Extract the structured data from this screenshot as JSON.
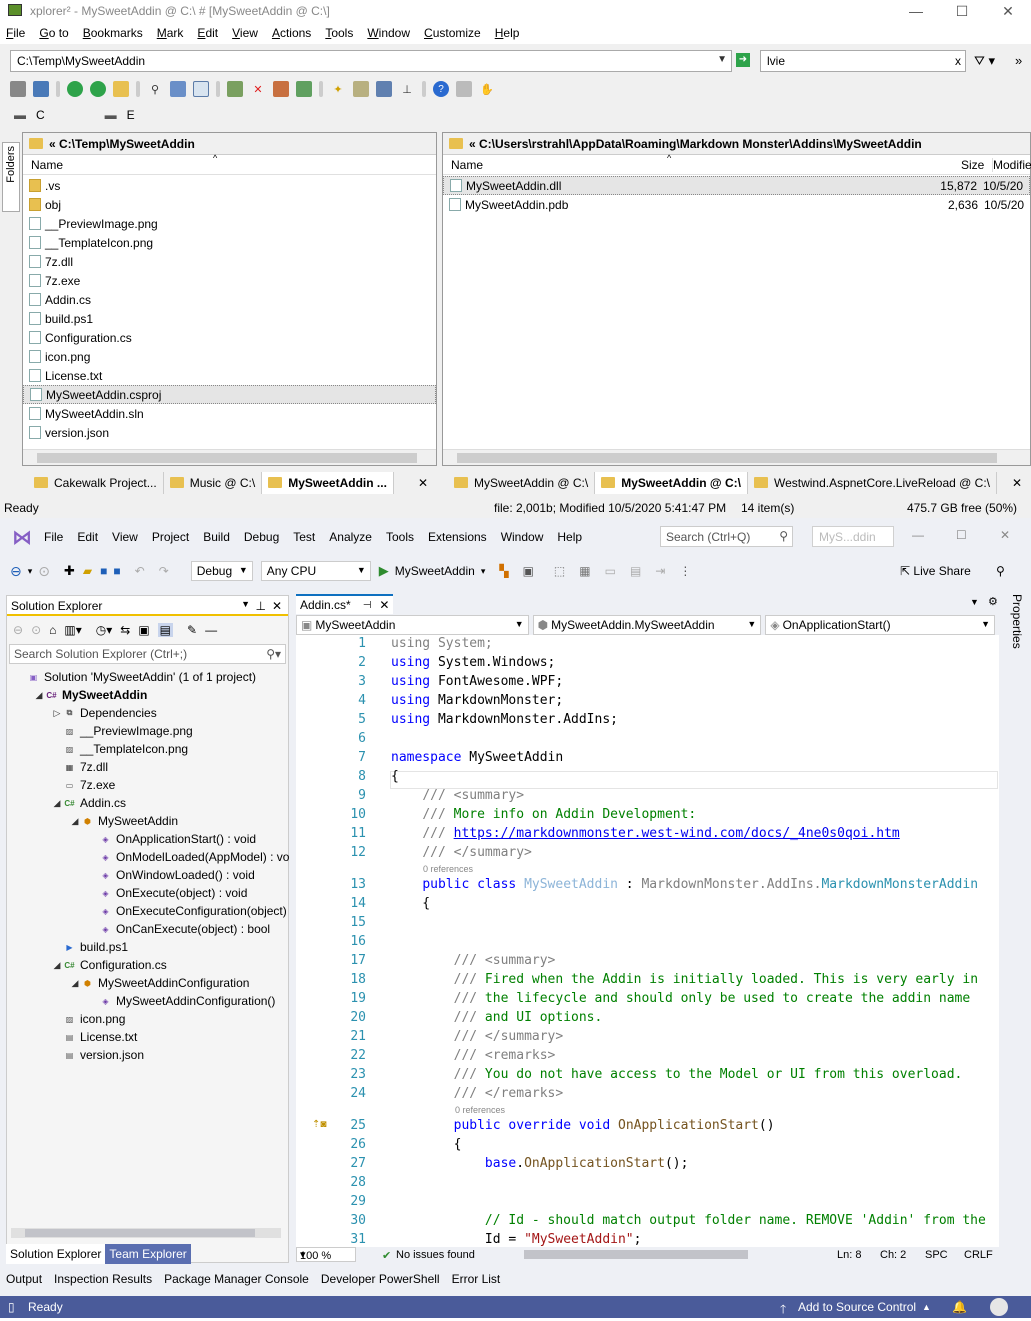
{
  "xplorer": {
    "title": "xplorer² - MySweetAddin @ C:\\ # [MySweetAddin @ C:\\]",
    "menu": [
      "File",
      "Go to",
      "Bookmarks",
      "Mark",
      "Edit",
      "View",
      "Actions",
      "Tools",
      "Window",
      "Customize",
      "Help"
    ],
    "address": "C:\\Temp\\MySweetAddin",
    "filter": "lvie",
    "drives": [
      "C",
      "E"
    ],
    "left": {
      "path": "C:\\Temp\\MySweetAddin",
      "col_name": "Name",
      "files": [
        ".vs",
        "obj",
        "__PreviewImage.png",
        "__TemplateIcon.png",
        "7z.dll",
        "7z.exe",
        "Addin.cs",
        "build.ps1",
        "Configuration.cs",
        "icon.png",
        "License.txt",
        "MySweetAddin.csproj",
        "MySweetAddin.sln",
        "version.json"
      ]
    },
    "right": {
      "path": "C:\\Users\\rstrahl\\AppData\\Roaming\\Markdown Monster\\Addins\\MySweetAddin",
      "col_name": "Name",
      "col_size": "Size",
      "col_modified": "Modifie",
      "files": [
        {
          "name": "MySweetAddin.dll",
          "size": "15,872",
          "date": "10/5/20"
        },
        {
          "name": "MySweetAddin.pdb",
          "size": "2,636",
          "date": "10/5/20"
        }
      ]
    },
    "left_tabs": [
      "Cakewalk Project...",
      "Music @ C:\\",
      "MySweetAddin ..."
    ],
    "right_tabs": [
      "MySweetAddin @ C:\\",
      "MySweetAddin @ C:\\",
      "Westwind.AspnetCore.LiveReload @ C:\\"
    ],
    "status": {
      "ready": "Ready",
      "file": "file: 2,001b; Modified 10/5/2020 5:41:47 PM",
      "items": "14 item(s)",
      "free": "475.7 GB free (50%)"
    }
  },
  "vs": {
    "menu": [
      "File",
      "Edit",
      "View",
      "Project",
      "Build",
      "Debug",
      "Test",
      "Analyze",
      "Tools",
      "Extensions",
      "Window",
      "Help"
    ],
    "search": "Search (Ctrl+Q)",
    "solution_name": "MyS...ddin",
    "config": "Debug",
    "platform": "Any CPU",
    "run": "MySweetAddin",
    "live_share": "Live Share",
    "sol": {
      "title": "Solution Explorer",
      "search": "Search Solution Explorer (Ctrl+;)",
      "tree": [
        {
          "t": "Solution 'MySweetAddin' (1 of 1 project)",
          "d": 0,
          "tog": "",
          "ic": "sol"
        },
        {
          "t": "MySweetAddin",
          "d": 1,
          "tog": "◢",
          "ic": "cs",
          "b": true
        },
        {
          "t": "Dependencies",
          "d": 2,
          "tog": "▷",
          "ic": "dep"
        },
        {
          "t": "__PreviewImage.png",
          "d": 2,
          "tog": "",
          "ic": "img"
        },
        {
          "t": "__TemplateIcon.png",
          "d": 2,
          "tog": "",
          "ic": "img"
        },
        {
          "t": "7z.dll",
          "d": 2,
          "tog": "",
          "ic": "dll"
        },
        {
          "t": "7z.exe",
          "d": 2,
          "tog": "",
          "ic": "exe"
        },
        {
          "t": "Addin.cs",
          "d": 2,
          "tog": "◢",
          "ic": "csf"
        },
        {
          "t": "MySweetAddin",
          "d": 3,
          "tog": "◢",
          "ic": "cls"
        },
        {
          "t": "OnApplicationStart() : void",
          "d": 4,
          "tog": "",
          "ic": "mth"
        },
        {
          "t": "OnModelLoaded(AppModel) : vo",
          "d": 4,
          "tog": "",
          "ic": "mth"
        },
        {
          "t": "OnWindowLoaded() : void",
          "d": 4,
          "tog": "",
          "ic": "mth"
        },
        {
          "t": "OnExecute(object) : void",
          "d": 4,
          "tog": "",
          "ic": "mth"
        },
        {
          "t": "OnExecuteConfiguration(object)",
          "d": 4,
          "tog": "",
          "ic": "mth"
        },
        {
          "t": "OnCanExecute(object) : bool",
          "d": 4,
          "tog": "",
          "ic": "mth"
        },
        {
          "t": "build.ps1",
          "d": 2,
          "tog": "",
          "ic": "ps"
        },
        {
          "t": "Configuration.cs",
          "d": 2,
          "tog": "◢",
          "ic": "csf"
        },
        {
          "t": "MySweetAddinConfiguration",
          "d": 3,
          "tog": "◢",
          "ic": "cls"
        },
        {
          "t": "MySweetAddinConfiguration()",
          "d": 4,
          "tog": "",
          "ic": "mth"
        },
        {
          "t": "icon.png",
          "d": 2,
          "tog": "",
          "ic": "img"
        },
        {
          "t": "License.txt",
          "d": 2,
          "tog": "",
          "ic": "txt"
        },
        {
          "t": "version.json",
          "d": 2,
          "tog": "",
          "ic": "txt"
        }
      ],
      "tabs": [
        "Solution Explorer",
        "Team Explorer"
      ]
    },
    "editor": {
      "tab": "Addin.cs*",
      "nav": [
        "MySweetAddin",
        "MySweetAddin.MySweetAddin",
        "OnApplicationStart()"
      ],
      "zoom": "100 %",
      "issues": "No issues found",
      "ln": "Ln: 8",
      "ch": "Ch: 2",
      "spc": "SPC",
      "crlf": "CRLF"
    },
    "bottom_tabs": [
      "Output",
      "Inspection Results",
      "Package Manager Console",
      "Developer PowerShell",
      "Error List"
    ],
    "status": {
      "ready": "Ready",
      "source": "Add to Source Control"
    },
    "properties": "Properties"
  }
}
